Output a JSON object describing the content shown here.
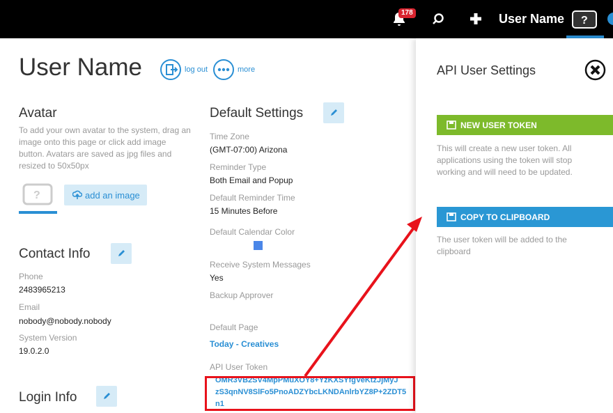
{
  "header": {
    "notification_count": "178",
    "username": "User Name"
  },
  "page": {
    "title": "User Name",
    "logout_label": "log out",
    "more_label": "more"
  },
  "avatar": {
    "heading": "Avatar",
    "help": "To add your own avatar to the system, drag an image onto this page or click add image button. Avatars are saved as jpg files and resized to 50x50px",
    "add_label": "add an image"
  },
  "contact": {
    "heading": "Contact Info",
    "phone_label": "Phone",
    "phone": "2483965213",
    "email_label": "Email",
    "email": "nobody@nobody.nobody",
    "version_label": "System Version",
    "version": "19.0.2.0"
  },
  "login": {
    "heading": "Login Info"
  },
  "defaults": {
    "heading": "Default Settings",
    "timezone_label": "Time Zone",
    "timezone": "(GMT-07:00) Arizona",
    "reminder_type_label": "Reminder Type",
    "reminder_type": "Both Email and Popup",
    "reminder_time_label": "Default Reminder Time",
    "reminder_time": "15 Minutes Before",
    "calendar_color_label": "Default Calendar Color",
    "calendar_color": "#4a86e8",
    "system_msgs_label": "Receive System Messages",
    "system_msgs": "Yes",
    "backup_label": "Backup Approver",
    "default_page_label": "Default Page",
    "default_page": "Today - Creatives",
    "api_token_label": "API User Token",
    "api_token_line1": "OMR3VB2SV4MpPMuXOY8+YzKXSYfgVeKtzJjMyJ",
    "api_token_line2": "zS3qnNV8SlFo5PnoADZYbcLKNDAnlrbYZ8P+2ZDT5",
    "api_token_line3": "n1"
  },
  "panel": {
    "title": "API User Settings",
    "new_token_label": "NEW USER TOKEN",
    "new_token_help": "This will create a new user token. All applications using the token will stop working and will need to be updated.",
    "copy_label": "COPY TO CLIPBOARD",
    "copy_help": "The user token will be added to the clipboard"
  },
  "colors": {
    "accent": "#2a8fd4",
    "green": "#7dba2b",
    "highlight": "#e8121b"
  }
}
